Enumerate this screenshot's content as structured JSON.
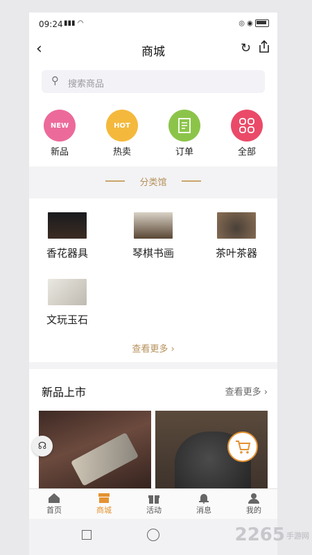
{
  "status": {
    "time": "09:24",
    "signal": "4G",
    "battery": "battery"
  },
  "nav": {
    "title": "商城"
  },
  "search": {
    "placeholder": "搜索商品"
  },
  "quick_links": [
    {
      "label": "新品",
      "badge": "NEW",
      "color": "#ec6a9a"
    },
    {
      "label": "热卖",
      "badge": "HOT",
      "color": "#f4b93c"
    },
    {
      "label": "订单",
      "badge": "",
      "color": "#8cc44a"
    },
    {
      "label": "全部",
      "badge": "",
      "color": "#ea4a68"
    }
  ],
  "section_divider": {
    "label": "分类馆"
  },
  "categories": [
    {
      "label": "香花器具"
    },
    {
      "label": "琴棋书画"
    },
    {
      "label": "茶叶茶器"
    },
    {
      "label": "文玩玉石"
    }
  ],
  "category_more": "查看更多",
  "new_arrivals": {
    "title": "新品上市",
    "more": "查看更多"
  },
  "tabbar": [
    {
      "label": "首页",
      "active": false
    },
    {
      "label": "商城",
      "active": true
    },
    {
      "label": "活动",
      "active": false
    },
    {
      "label": "消息",
      "active": false
    },
    {
      "label": "我的",
      "active": false
    }
  ],
  "watermark": {
    "brand": "2265",
    "site": "手游网"
  },
  "colors": {
    "accent": "#e49232",
    "gold": "#b6905a"
  }
}
